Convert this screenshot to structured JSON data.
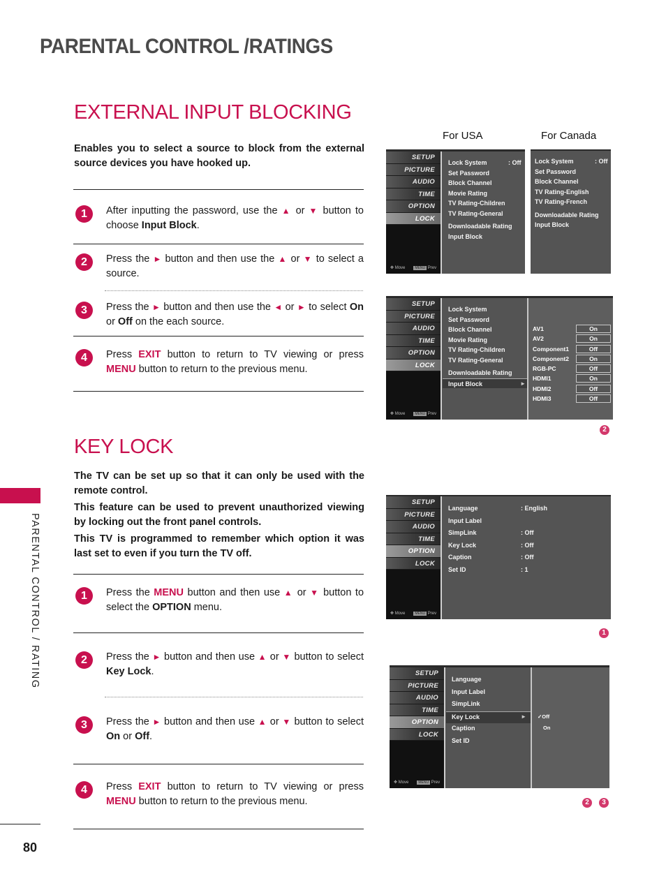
{
  "page": {
    "title": "PARENTAL CONTROL /RATINGS",
    "side_label": "PARENTAL CONTROL / RATING",
    "page_number": "80",
    "accent_color": "#c8104e"
  },
  "external_input": {
    "title": "EXTERNAL INPUT BLOCKING",
    "intro": "Enables you to select a source to block from the external source devices you have hooked up.",
    "steps": [
      {
        "num": "1",
        "parts": [
          "After inputting the password, use the ",
          "▲",
          " or ",
          "▼",
          " button to choose ",
          "Input Block",
          "."
        ]
      },
      {
        "num": "2",
        "parts": [
          "Press the ",
          "►",
          " button and then use the ",
          "▲",
          " or ",
          "▼",
          " to select a source."
        ]
      },
      {
        "num": "3",
        "parts": [
          "Press the ",
          "►",
          " button and then use the ",
          "◄",
          " or ",
          "►",
          " to select ",
          "On",
          " or ",
          "Off",
          " on the each source."
        ]
      },
      {
        "num": "4",
        "parts": [
          "Press ",
          "EXIT",
          " button to return to TV viewing or press ",
          "MENU",
          " button to return to the previous menu."
        ]
      }
    ]
  },
  "key_lock": {
    "title": "KEY LOCK",
    "paragraphs": [
      "The TV can be set up so that it can only be used with the remote control.",
      "This feature can be used to prevent unauthorized viewing by locking out the front panel controls.",
      "This TV is programmed to remember which option it was last set to even if you turn the TV off."
    ],
    "steps": [
      {
        "num": "1",
        "parts": [
          "Press the ",
          "MENU",
          " button and then use ",
          "▲",
          " or ",
          "▼",
          " button to select the ",
          "OPTION",
          " menu."
        ]
      },
      {
        "num": "2",
        "parts": [
          "Press the ",
          "►",
          " button and then use ",
          "▲",
          " or ",
          "▼",
          " button to select ",
          "Key Lock",
          "."
        ]
      },
      {
        "num": "3",
        "parts": [
          "Press the ",
          "►",
          " button and then use ",
          "▲",
          " or ",
          "▼",
          " button to select ",
          "On",
          " or ",
          "Off",
          "."
        ]
      },
      {
        "num": "4",
        "parts": [
          "Press ",
          "EXIT",
          " button to return to TV viewing or press ",
          "MENU",
          " button to return to the previous menu."
        ]
      }
    ]
  },
  "osd_common": {
    "nav_items": [
      "SETUP",
      "PICTURE",
      "AUDIO",
      "TIME",
      "OPTION",
      "LOCK"
    ],
    "move_label": "Move",
    "menu_btn": "MENU",
    "prev_label": "Prev"
  },
  "screens": {
    "usa_label": "For USA",
    "canada_label": "For Canada",
    "usa_lock": {
      "active_nav": "LOCK",
      "items": [
        {
          "label": "Lock System",
          "value": ": Off"
        },
        {
          "label": "Set Password"
        },
        {
          "label": "Block Channel"
        },
        {
          "label": "Movie Rating"
        },
        {
          "label": "TV Rating-Children"
        },
        {
          "label": "TV Rating-General"
        },
        {
          "label": "Downloadable Rating"
        },
        {
          "label": "Input Block"
        }
      ]
    },
    "canada_lock": {
      "items": [
        {
          "label": "Lock System",
          "value": ": Off"
        },
        {
          "label": "Set Password"
        },
        {
          "label": "Block Channel"
        },
        {
          "label": "TV Rating-English"
        },
        {
          "label": "TV Rating-French"
        },
        {
          "label": "Downloadable Rating"
        },
        {
          "label": "Input Block"
        }
      ]
    },
    "input_block": {
      "items": [
        "Lock System",
        "Set Password",
        "Block Channel",
        "Movie Rating",
        "TV Rating-Children",
        "TV Rating-General",
        "Downloadable Rating",
        "Input Block"
      ],
      "selected": "Input Block",
      "sources": [
        {
          "name": "AV1",
          "state": "On"
        },
        {
          "name": "AV2",
          "state": "On"
        },
        {
          "name": "Component1",
          "state": "Off"
        },
        {
          "name": "Component2",
          "state": "On"
        },
        {
          "name": "RGB-PC",
          "state": "Off"
        },
        {
          "name": "HDMI1",
          "state": "On"
        },
        {
          "name": "HDMI2",
          "state": "Off"
        },
        {
          "name": "HDMI3",
          "state": "Off"
        }
      ],
      "badge": "2"
    },
    "option_menu": {
      "active_nav": "OPTION",
      "items": [
        {
          "label": "Language",
          "value": ": English"
        },
        {
          "label": "Input Label"
        },
        {
          "label": "SimpLink",
          "value": ": Off"
        },
        {
          "label": "Key Lock",
          "value": ": Off"
        },
        {
          "label": "Caption",
          "value": ": Off"
        },
        {
          "label": "Set ID",
          "value": ": 1"
        }
      ],
      "badge": "1"
    },
    "key_lock_menu": {
      "items": [
        "Language",
        "Input Label",
        "SimpLink",
        "Key Lock",
        "Caption",
        "Set ID"
      ],
      "selected": "Key Lock",
      "options": [
        {
          "label": "Off",
          "checked": true
        },
        {
          "label": "On",
          "checked": false
        }
      ],
      "badges": [
        "2",
        "3"
      ]
    }
  }
}
